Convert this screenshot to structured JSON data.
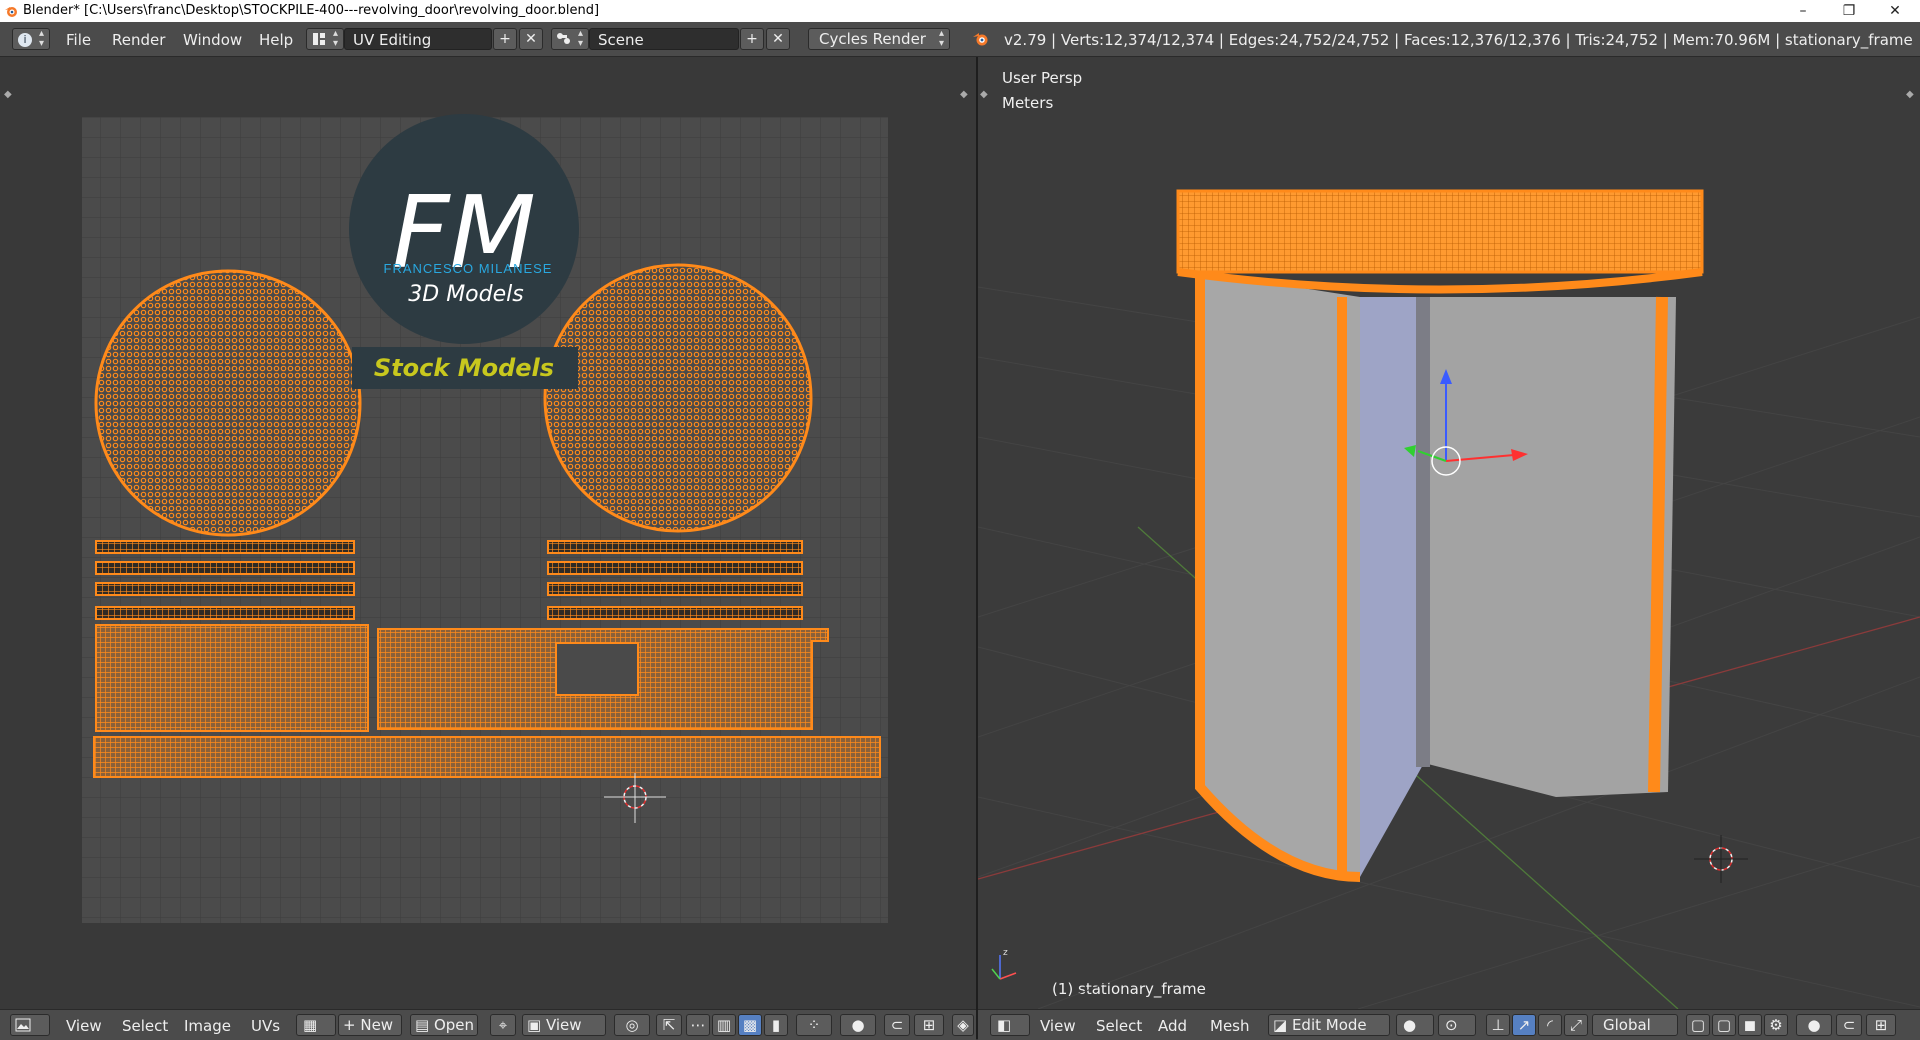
{
  "window": {
    "title": "Blender* [C:\\Users\\franc\\Desktop\\STOCKPILE-400---revolving_door\\revolving_door.blend]",
    "minimize": "–",
    "maximize": "❐",
    "close": "✕"
  },
  "menu": {
    "info_icon": "i",
    "file": "File",
    "render": "Render",
    "window": "Window",
    "help": "Help"
  },
  "screen_layout": {
    "value": "UV Editing"
  },
  "scene": {
    "value": "Scene"
  },
  "render_engine": {
    "value": "Cycles Render"
  },
  "stats": "v2.79 | Verts:12,374/12,374 | Edges:24,752/24,752 | Faces:12,376/12,376 | Tris:24,752 | Mem:70.96M | stationary_frame",
  "uv_image": {
    "logo_letters": "FM",
    "logo_name": "FRANCESCO MILANESE",
    "logo_sub": "3D Models",
    "banner": "Stock Models"
  },
  "viewport": {
    "persp_label": "User Persp",
    "units_label": "Meters",
    "object_label": "(1) stationary_frame"
  },
  "uv_header": {
    "view": "View",
    "select": "Select",
    "image": "Image",
    "uvs": "UVs",
    "new": "New",
    "open": "Open",
    "view2": "View"
  },
  "v3d_header": {
    "view": "View",
    "select": "Select",
    "add": "Add",
    "mesh": "Mesh",
    "mode": "Edit Mode",
    "orientation": "Global"
  },
  "colors": {
    "wire": "#ff8a1a",
    "uv_bg": "#4a4a4a",
    "viewport_bg": "#3b3b3b",
    "header_bg": "#4b4b4b",
    "logo_blue": "#29a8e0",
    "banner_text": "#c8c81e"
  }
}
